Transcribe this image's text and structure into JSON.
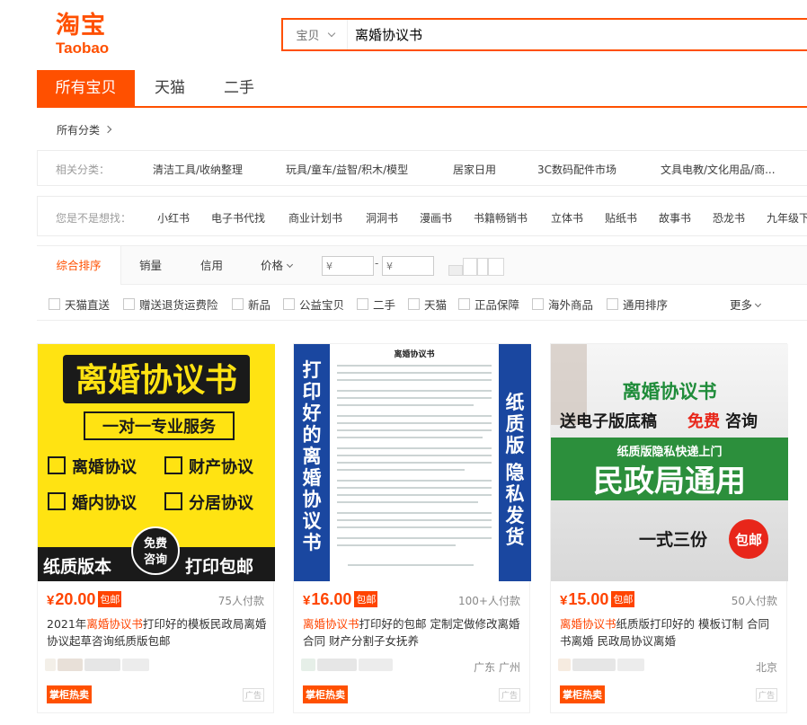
{
  "logo": {
    "cn": "淘宝",
    "en": "Taobao"
  },
  "search": {
    "scope": "宝贝",
    "query": "离婚协议书"
  },
  "tabs": [
    "所有宝贝",
    "天猫",
    "二手"
  ],
  "categories": {
    "all_label": "所有分类"
  },
  "related": {
    "label": "相关分类：",
    "items": [
      "清洁工具/收纳整理",
      "玩具/童车/益智/积木/模型",
      "居家日用",
      "3C数码配件市场",
      "文具电教/文化用品/商..."
    ]
  },
  "suggest": {
    "label": "您是不是想找：",
    "items": [
      "小红书",
      "电子书代找",
      "商业计划书",
      "洞洞书",
      "漫画书",
      "书籍畅销书",
      "立体书",
      "贴纸书",
      "故事书",
      "恐龙书",
      "九年级下"
    ]
  },
  "sort": {
    "items": [
      "综合排序",
      "销量",
      "信用",
      "价格"
    ],
    "price_from_placeholder": "¥",
    "price_to_placeholder": "¥",
    "dash": "-"
  },
  "checks": [
    "天猫直送",
    "赠送退货运费险",
    "新品",
    "公益宝贝",
    "二手",
    "天猫",
    "正品保障",
    "海外商品",
    "通用排序"
  ],
  "more_label": "更多",
  "colors": {
    "accent": "#ff5000",
    "price": "#ff4400"
  },
  "products": [
    {
      "price": "20.00",
      "currency": "¥",
      "post_badge": "包邮",
      "sales": "75人付款",
      "title_pre": "2021年",
      "title_hl": "离婚协议书",
      "title_post": "打印好的模板民政局离婚协议起草咨询纸质版包邮",
      "location": "",
      "hot_badge": "掌柜热卖",
      "ad_label": "广告",
      "image": {
        "headline": "离婚协议书",
        "sub": "一对一专业服务",
        "checks": [
          "离婚协议",
          "财产协议",
          "婚内协议",
          "分居协议"
        ],
        "footer_left": "纸质版本",
        "circle_top": "免费",
        "circle_bottom": "咨询",
        "footer_right": "打印包邮"
      }
    },
    {
      "price": "16.00",
      "currency": "¥",
      "post_badge": "包邮",
      "sales": "100+人付款",
      "title_pre": "",
      "title_hl": "离婚协议书",
      "title_post": "打印好的包邮 定制定做修改离婚合同 财产分割子女抚养",
      "location": "广东 广州",
      "hot_badge": "掌柜热卖",
      "ad_label": "广告",
      "image": {
        "left_vertical": "打印好的离婚协议书",
        "right_vertical": "纸质版 隐私发货",
        "doc_title": "离婚协议书"
      }
    },
    {
      "price": "15.00",
      "currency": "¥",
      "post_badge": "包邮",
      "sales": "50人付款",
      "title_pre": "",
      "title_hl": "离婚协议书",
      "title_post": "纸质版打印好的 模板订制 合同书离婚 民政局协议离婚",
      "location": "北京",
      "hot_badge": "掌柜热卖",
      "ad_label": "广告",
      "image": {
        "headline": "离婚协议书",
        "line2_a": "送电子版底稿",
        "line2_b": "免费",
        "line2_c": "咨询",
        "banner_small": "纸质版隐私快递上门",
        "banner_big": "民政局通用",
        "bottom_a": "一式三份",
        "bottom_b": "包邮"
      }
    }
  ]
}
